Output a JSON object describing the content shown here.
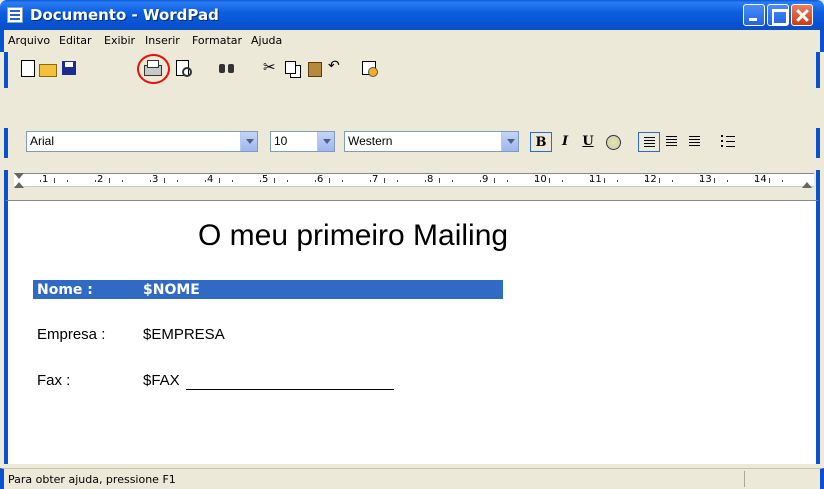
{
  "window": {
    "title": "Documento - WordPad"
  },
  "menu": [
    {
      "label": "Arquivo"
    },
    {
      "label": "Editar"
    },
    {
      "label": "Exibir"
    },
    {
      "label": "Inserir"
    },
    {
      "label": "Formatar"
    },
    {
      "label": "Ajuda"
    }
  ],
  "toolbar": {
    "icons": [
      "new-document-icon",
      "open-folder-icon",
      "save-icon",
      "print-icon",
      "print-preview-icon",
      "find-icon",
      "cut-icon",
      "copy-icon",
      "paste-icon",
      "undo-icon",
      "date-time-icon"
    ],
    "highlight_color": "#e8100a"
  },
  "format": {
    "font": "Arial",
    "size": "10",
    "script": "Western",
    "bold": "B",
    "italic": "I",
    "underline": "U"
  },
  "ruler": {
    "numbers": [
      "1",
      "2",
      "3",
      "4",
      "5",
      "6",
      "7",
      "8",
      "9",
      "10",
      "11",
      "12",
      "13",
      "14"
    ]
  },
  "document": {
    "title": "O meu primeiro Mailing",
    "fields": [
      {
        "label": "Nome :",
        "value": "$NOME",
        "selected": true
      },
      {
        "label": "Empresa :",
        "value": "$EMPRESA",
        "selected": false
      },
      {
        "label": "Fax :",
        "value": "$FAX",
        "selected": false
      }
    ],
    "selection_color": "#316ac5"
  },
  "status": {
    "text": "Para obter ajuda, pressione F1"
  }
}
